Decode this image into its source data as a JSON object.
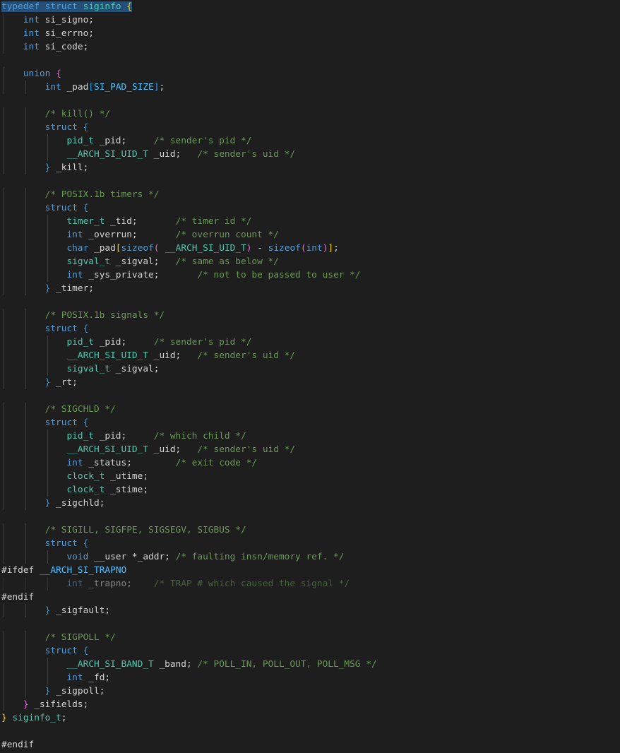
{
  "editor": {
    "theme_colors": {
      "background": "#1e1e1e",
      "keyword": "#569cd6",
      "type": "#4ec9b0",
      "variable": "#9cdcfe",
      "comment": "#6a9955",
      "macro": "#4fc1ff",
      "function": "#dcdcaa",
      "preprocessor": "#c586c0",
      "selection": "#264f78"
    },
    "lines": [
      {
        "indent": 0,
        "tokens": [
          {
            "t": "typedef",
            "c": "kw sel"
          },
          {
            "t": " ",
            "c": "sel"
          },
          {
            "t": "struct",
            "c": "kw sel"
          },
          {
            "t": " ",
            "c": "sel"
          },
          {
            "t": "siginfo",
            "c": "ty sel"
          },
          {
            "t": " ",
            "c": "sel"
          },
          {
            "t": "{",
            "c": "br1 sel"
          }
        ]
      },
      {
        "indent": 1,
        "tokens": [
          {
            "t": "int",
            "c": "kw"
          },
          {
            "t": " si_signo;",
            "c": ""
          }
        ]
      },
      {
        "indent": 1,
        "tokens": [
          {
            "t": "int",
            "c": "kw"
          },
          {
            "t": " si_errno;",
            "c": ""
          }
        ]
      },
      {
        "indent": 1,
        "tokens": [
          {
            "t": "int",
            "c": "kw"
          },
          {
            "t": " si_code;",
            "c": ""
          }
        ]
      },
      {
        "indent": 0,
        "tokens": []
      },
      {
        "indent": 1,
        "tokens": [
          {
            "t": "union",
            "c": "kw"
          },
          {
            "t": " ",
            "c": ""
          },
          {
            "t": "{",
            "c": "br2"
          }
        ]
      },
      {
        "indent": 2,
        "tokens": [
          {
            "t": "int",
            "c": "kw"
          },
          {
            "t": " _pad",
            "c": ""
          },
          {
            "t": "[",
            "c": "br3"
          },
          {
            "t": "SI_PAD_SIZE",
            "c": "mac"
          },
          {
            "t": "]",
            "c": "br3"
          },
          {
            "t": ";",
            "c": ""
          }
        ]
      },
      {
        "indent": 0,
        "tokens": []
      },
      {
        "indent": 2,
        "tokens": [
          {
            "t": "/* kill() */",
            "c": "cm"
          }
        ]
      },
      {
        "indent": 2,
        "tokens": [
          {
            "t": "struct",
            "c": "kw"
          },
          {
            "t": " ",
            "c": ""
          },
          {
            "t": "{",
            "c": "br3"
          }
        ]
      },
      {
        "indent": 3,
        "tokens": [
          {
            "t": "pid_t",
            "c": "ty"
          },
          {
            "t": " _pid;     ",
            "c": ""
          },
          {
            "t": "/* sender's pid */",
            "c": "cm"
          }
        ]
      },
      {
        "indent": 3,
        "tokens": [
          {
            "t": "__ARCH_SI_UID_T",
            "c": "ty"
          },
          {
            "t": " _uid;   ",
            "c": ""
          },
          {
            "t": "/* sender's uid */",
            "c": "cm"
          }
        ]
      },
      {
        "indent": 2,
        "tokens": [
          {
            "t": "}",
            "c": "br3"
          },
          {
            "t": " _kill;",
            "c": ""
          }
        ]
      },
      {
        "indent": 0,
        "tokens": []
      },
      {
        "indent": 2,
        "tokens": [
          {
            "t": "/* POSIX.1b timers */",
            "c": "cm"
          }
        ]
      },
      {
        "indent": 2,
        "tokens": [
          {
            "t": "struct",
            "c": "kw"
          },
          {
            "t": " ",
            "c": ""
          },
          {
            "t": "{",
            "c": "br3"
          }
        ]
      },
      {
        "indent": 3,
        "tokens": [
          {
            "t": "timer_t",
            "c": "ty"
          },
          {
            "t": " _tid;       ",
            "c": ""
          },
          {
            "t": "/* timer id */",
            "c": "cm"
          }
        ]
      },
      {
        "indent": 3,
        "tokens": [
          {
            "t": "int",
            "c": "kw"
          },
          {
            "t": " _overrun;       ",
            "c": ""
          },
          {
            "t": "/* overrun count */",
            "c": "cm"
          }
        ]
      },
      {
        "indent": 3,
        "tokens": [
          {
            "t": "char",
            "c": "kw"
          },
          {
            "t": " _pad",
            "c": ""
          },
          {
            "t": "[",
            "c": "br1"
          },
          {
            "t": "sizeof",
            "c": "kw"
          },
          {
            "t": "(",
            "c": "br2"
          },
          {
            "t": " ",
            "c": ""
          },
          {
            "t": "__ARCH_SI_UID_T",
            "c": "ty"
          },
          {
            "t": ")",
            "c": "br2"
          },
          {
            "t": " - ",
            "c": ""
          },
          {
            "t": "sizeof",
            "c": "kw"
          },
          {
            "t": "(",
            "c": "br2"
          },
          {
            "t": "int",
            "c": "kw"
          },
          {
            "t": ")",
            "c": "br2"
          },
          {
            "t": "]",
            "c": "br1"
          },
          {
            "t": ";",
            "c": ""
          }
        ]
      },
      {
        "indent": 3,
        "tokens": [
          {
            "t": "sigval_t",
            "c": "ty"
          },
          {
            "t": " _sigval;   ",
            "c": ""
          },
          {
            "t": "/* same as below */",
            "c": "cm"
          }
        ]
      },
      {
        "indent": 3,
        "tokens": [
          {
            "t": "int",
            "c": "kw"
          },
          {
            "t": " _sys_private;       ",
            "c": ""
          },
          {
            "t": "/* not to be passed to user */",
            "c": "cm"
          }
        ]
      },
      {
        "indent": 2,
        "tokens": [
          {
            "t": "}",
            "c": "br3"
          },
          {
            "t": " _timer;",
            "c": ""
          }
        ]
      },
      {
        "indent": 0,
        "tokens": []
      },
      {
        "indent": 2,
        "tokens": [
          {
            "t": "/* POSIX.1b signals */",
            "c": "cm"
          }
        ]
      },
      {
        "indent": 2,
        "tokens": [
          {
            "t": "struct",
            "c": "kw"
          },
          {
            "t": " ",
            "c": ""
          },
          {
            "t": "{",
            "c": "br3"
          }
        ]
      },
      {
        "indent": 3,
        "tokens": [
          {
            "t": "pid_t",
            "c": "ty"
          },
          {
            "t": " _pid;     ",
            "c": ""
          },
          {
            "t": "/* sender's pid */",
            "c": "cm"
          }
        ]
      },
      {
        "indent": 3,
        "tokens": [
          {
            "t": "__ARCH_SI_UID_T",
            "c": "ty"
          },
          {
            "t": " _uid;   ",
            "c": ""
          },
          {
            "t": "/* sender's uid */",
            "c": "cm"
          }
        ]
      },
      {
        "indent": 3,
        "tokens": [
          {
            "t": "sigval_t",
            "c": "ty"
          },
          {
            "t": " _sigval;",
            "c": ""
          }
        ]
      },
      {
        "indent": 2,
        "tokens": [
          {
            "t": "}",
            "c": "br3"
          },
          {
            "t": " _rt;",
            "c": ""
          }
        ]
      },
      {
        "indent": 0,
        "tokens": []
      },
      {
        "indent": 2,
        "tokens": [
          {
            "t": "/* SIGCHLD */",
            "c": "cm"
          }
        ]
      },
      {
        "indent": 2,
        "tokens": [
          {
            "t": "struct",
            "c": "kw"
          },
          {
            "t": " ",
            "c": ""
          },
          {
            "t": "{",
            "c": "br3"
          }
        ]
      },
      {
        "indent": 3,
        "tokens": [
          {
            "t": "pid_t",
            "c": "ty"
          },
          {
            "t": " _pid;     ",
            "c": ""
          },
          {
            "t": "/* which child */",
            "c": "cm"
          }
        ]
      },
      {
        "indent": 3,
        "tokens": [
          {
            "t": "__ARCH_SI_UID_T",
            "c": "ty"
          },
          {
            "t": " _uid;   ",
            "c": ""
          },
          {
            "t": "/* sender's uid */",
            "c": "cm"
          }
        ]
      },
      {
        "indent": 3,
        "tokens": [
          {
            "t": "int",
            "c": "kw"
          },
          {
            "t": " _status;        ",
            "c": ""
          },
          {
            "t": "/* exit code */",
            "c": "cm"
          }
        ]
      },
      {
        "indent": 3,
        "tokens": [
          {
            "t": "clock_t",
            "c": "ty"
          },
          {
            "t": " _utime;",
            "c": ""
          }
        ]
      },
      {
        "indent": 3,
        "tokens": [
          {
            "t": "clock_t",
            "c": "ty"
          },
          {
            "t": " _stime;",
            "c": ""
          }
        ]
      },
      {
        "indent": 2,
        "tokens": [
          {
            "t": "}",
            "c": "br3"
          },
          {
            "t": " _sigchld;",
            "c": ""
          }
        ]
      },
      {
        "indent": 0,
        "tokens": []
      },
      {
        "indent": 2,
        "tokens": [
          {
            "t": "/* SIGILL, SIGFPE, SIGSEGV, SIGBUS */",
            "c": "cm"
          }
        ]
      },
      {
        "indent": 2,
        "tokens": [
          {
            "t": "struct",
            "c": "kw"
          },
          {
            "t": " ",
            "c": ""
          },
          {
            "t": "{",
            "c": "br3"
          }
        ]
      },
      {
        "indent": 3,
        "tokens": [
          {
            "t": "void",
            "c": "kw"
          },
          {
            "t": " __user *_addr; ",
            "c": ""
          },
          {
            "t": "/* faulting insn/memory ref. */",
            "c": "cm"
          }
        ]
      },
      {
        "indent": 0,
        "tokens": [
          {
            "t": "#ifdef",
            "c": ""
          },
          {
            "t": " ",
            "c": ""
          },
          {
            "t": "__ARCH_SI_TRAPNO",
            "c": "mac"
          }
        ]
      },
      {
        "indent": 3,
        "dim": true,
        "tokens": [
          {
            "t": "int",
            "c": "kw"
          },
          {
            "t": " _trapno;    ",
            "c": ""
          },
          {
            "t": "/* TRAP # which caused the signal */",
            "c": "cm"
          }
        ]
      },
      {
        "indent": 0,
        "tokens": [
          {
            "t": "#endif",
            "c": ""
          }
        ]
      },
      {
        "indent": 2,
        "tokens": [
          {
            "t": "}",
            "c": "br3"
          },
          {
            "t": " _sigfault;",
            "c": ""
          }
        ]
      },
      {
        "indent": 0,
        "tokens": []
      },
      {
        "indent": 2,
        "tokens": [
          {
            "t": "/* SIGPOLL */",
            "c": "cm"
          }
        ]
      },
      {
        "indent": 2,
        "tokens": [
          {
            "t": "struct",
            "c": "kw"
          },
          {
            "t": " ",
            "c": ""
          },
          {
            "t": "{",
            "c": "br3"
          }
        ]
      },
      {
        "indent": 3,
        "tokens": [
          {
            "t": "__ARCH_SI_BAND_T",
            "c": "ty"
          },
          {
            "t": " _band; ",
            "c": ""
          },
          {
            "t": "/* POLL_IN, POLL_OUT, POLL_MSG */",
            "c": "cm"
          }
        ]
      },
      {
        "indent": 3,
        "tokens": [
          {
            "t": "int",
            "c": "kw"
          },
          {
            "t": " _fd;",
            "c": ""
          }
        ]
      },
      {
        "indent": 2,
        "tokens": [
          {
            "t": "}",
            "c": "br3"
          },
          {
            "t": " _sigpoll;",
            "c": ""
          }
        ]
      },
      {
        "indent": 1,
        "tokens": [
          {
            "t": "}",
            "c": "br2"
          },
          {
            "t": " _sifields;",
            "c": ""
          }
        ]
      },
      {
        "indent": 0,
        "tokens": [
          {
            "t": "}",
            "c": "br1"
          },
          {
            "t": " ",
            "c": ""
          },
          {
            "t": "siginfo_t",
            "c": "ty"
          },
          {
            "t": ";",
            "c": ""
          }
        ]
      },
      {
        "indent": 0,
        "tokens": []
      },
      {
        "indent": 0,
        "tokens": [
          {
            "t": "#endif",
            "c": ""
          }
        ]
      }
    ]
  }
}
